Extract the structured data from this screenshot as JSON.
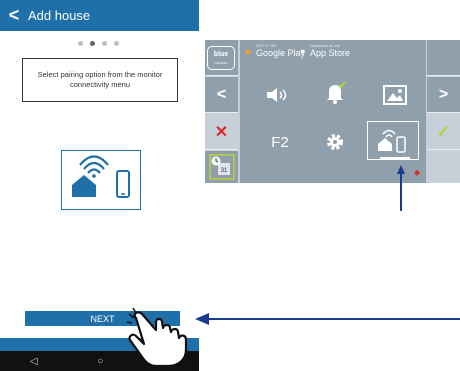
{
  "phone": {
    "appbar": {
      "back": "<",
      "title": "Add house"
    },
    "pager_dots": 4,
    "active_dot": 1,
    "message": "Select pairing option from the monitor connectivity menu",
    "next_label": "NEXT",
    "nav": {
      "back": "◁",
      "home": "○",
      "recent": "□"
    }
  },
  "monitor": {
    "logo": "blue",
    "logo_sub": "GOLMAR",
    "google": {
      "small": "GET IT ON",
      "big": "Google Play"
    },
    "apple": {
      "small": "Download on the",
      "big": "App Store"
    },
    "left_nav": "<",
    "right_nav": ">",
    "cancel": "✕",
    "confirm": "✓",
    "icons": [
      "speaker-icon",
      "bell-icon",
      "image-icon",
      "f2-label",
      "gear-icon",
      "connectivity-icon"
    ],
    "f2": "F2",
    "calendar_day": "31"
  },
  "colors": {
    "brand_blue": "#1f6fa8",
    "monitor_bg": "#8f9fac",
    "accent_green": "#b5d334",
    "cancel_red": "#d92b2b",
    "arrow": "#1a3c8c"
  }
}
